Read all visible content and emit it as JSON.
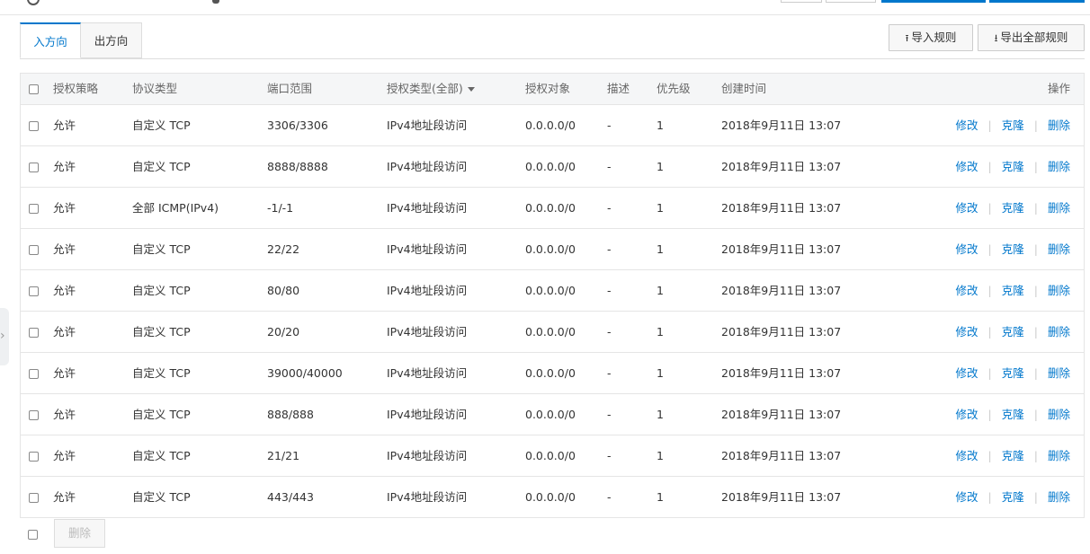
{
  "tabs": [
    {
      "label": "入方向",
      "active": true
    },
    {
      "label": "出方向",
      "active": false
    }
  ],
  "toolbar": {
    "import_label": "导入规则",
    "export_label": "导出全部规则",
    "import_icon": "upload-icon",
    "export_icon": "download-icon"
  },
  "table": {
    "columns": [
      "授权策略",
      "协议类型",
      "端口范围",
      "授权类型(全部)",
      "授权对象",
      "描述",
      "优先级",
      "创建时间",
      "操作"
    ],
    "rows": [
      {
        "policy": "允许",
        "protocol": "自定义 TCP",
        "port": "3306/3306",
        "auth_type": "IPv4地址段访问",
        "target": "0.0.0.0/0",
        "desc": "-",
        "priority": "1",
        "created": "2018年9月11日 13:07"
      },
      {
        "policy": "允许",
        "protocol": "自定义 TCP",
        "port": "8888/8888",
        "auth_type": "IPv4地址段访问",
        "target": "0.0.0.0/0",
        "desc": "-",
        "priority": "1",
        "created": "2018年9月11日 13:07"
      },
      {
        "policy": "允许",
        "protocol": "全部 ICMP(IPv4)",
        "port": "-1/-1",
        "auth_type": "IPv4地址段访问",
        "target": "0.0.0.0/0",
        "desc": "-",
        "priority": "1",
        "created": "2018年9月11日 13:07"
      },
      {
        "policy": "允许",
        "protocol": "自定义 TCP",
        "port": "22/22",
        "auth_type": "IPv4地址段访问",
        "target": "0.0.0.0/0",
        "desc": "-",
        "priority": "1",
        "created": "2018年9月11日 13:07"
      },
      {
        "policy": "允许",
        "protocol": "自定义 TCP",
        "port": "80/80",
        "auth_type": "IPv4地址段访问",
        "target": "0.0.0.0/0",
        "desc": "-",
        "priority": "1",
        "created": "2018年9月11日 13:07"
      },
      {
        "policy": "允许",
        "protocol": "自定义 TCP",
        "port": "20/20",
        "auth_type": "IPv4地址段访问",
        "target": "0.0.0.0/0",
        "desc": "-",
        "priority": "1",
        "created": "2018年9月11日 13:07"
      },
      {
        "policy": "允许",
        "protocol": "自定义 TCP",
        "port": "39000/40000",
        "auth_type": "IPv4地址段访问",
        "target": "0.0.0.0/0",
        "desc": "-",
        "priority": "1",
        "created": "2018年9月11日 13:07"
      },
      {
        "policy": "允许",
        "protocol": "自定义 TCP",
        "port": "888/888",
        "auth_type": "IPv4地址段访问",
        "target": "0.0.0.0/0",
        "desc": "-",
        "priority": "1",
        "created": "2018年9月11日 13:07"
      },
      {
        "policy": "允许",
        "protocol": "自定义 TCP",
        "port": "21/21",
        "auth_type": "IPv4地址段访问",
        "target": "0.0.0.0/0",
        "desc": "-",
        "priority": "1",
        "created": "2018年9月11日 13:07"
      },
      {
        "policy": "允许",
        "protocol": "自定义 TCP",
        "port": "443/443",
        "auth_type": "IPv4地址段访问",
        "target": "0.0.0.0/0",
        "desc": "-",
        "priority": "1",
        "created": "2018年9月11日 13:07"
      }
    ],
    "row_actions": {
      "edit": "修改",
      "clone": "克隆",
      "delete": "删除"
    }
  },
  "footer": {
    "delete_label": "删除"
  },
  "colors": {
    "accent": "#0077cc",
    "header_bg": "#f5f6f7",
    "border": "#e5e5e5"
  }
}
